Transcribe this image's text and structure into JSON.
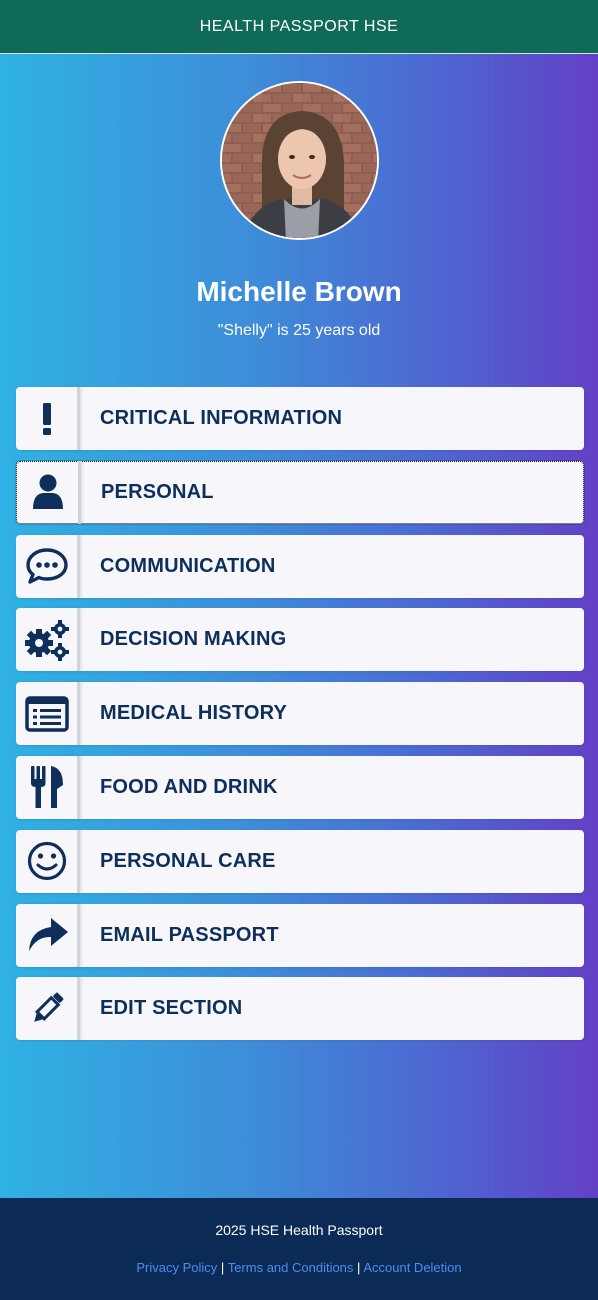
{
  "header": {
    "title": "HEALTH PASSPORT HSE"
  },
  "profile": {
    "name": "Michelle Brown",
    "nickname": "Shelly",
    "age_text": "is 25 years old"
  },
  "menu": [
    {
      "label": "CRITICAL INFORMATION",
      "icon": "exclamation-icon"
    },
    {
      "label": "PERSONAL",
      "icon": "user-icon"
    },
    {
      "label": "COMMUNICATION",
      "icon": "speech-bubble-icon"
    },
    {
      "label": "DECISION MAKING",
      "icon": "gears-icon"
    },
    {
      "label": "MEDICAL HISTORY",
      "icon": "list-card-icon"
    },
    {
      "label": "FOOD AND DRINK",
      "icon": "utensils-icon"
    },
    {
      "label": "PERSONAL CARE",
      "icon": "smile-icon"
    },
    {
      "label": "EMAIL PASSPORT",
      "icon": "share-arrow-icon"
    },
    {
      "label": "EDIT SECTION",
      "icon": "pencil-icon"
    }
  ],
  "footer": {
    "copyright": "2025 HSE Health Passport",
    "links": {
      "privacy": "Privacy Policy",
      "terms": "Terms and Conditions",
      "deletion": "Account Deletion"
    },
    "separator": "|"
  },
  "colors": {
    "topbar": "#0f6b57",
    "gradient_start": "#2fb2e3",
    "gradient_end": "#6340c6",
    "footer": "#0b2a55",
    "menu_text": "#0d2f5a",
    "link": "#4d8df2"
  }
}
